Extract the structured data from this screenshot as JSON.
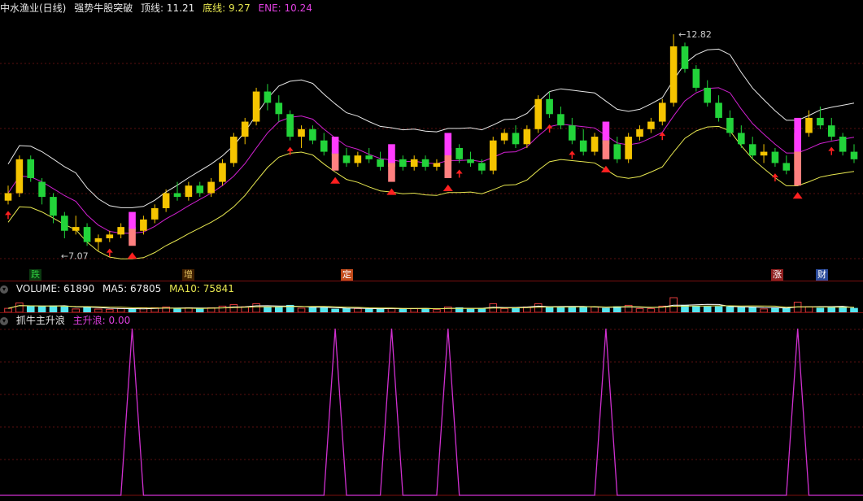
{
  "colors": {
    "up": "#f5c400",
    "down": "#22d33a",
    "top_line": "#e8e8e8",
    "mid_line": "#d020d0",
    "bottom_line": "#e8e850",
    "vol_up": "#e03b3b",
    "vol_down": "#55e6f0",
    "ma5": "#ffffff",
    "ma10": "#e8e850",
    "signal": "#d030d0",
    "marker": "#ff2020",
    "highlight": "#ff3cff"
  },
  "main": {
    "stock": "中水渔业(日线)",
    "indicator": "强势牛股突破",
    "top_label": "顶线:",
    "top_value": "11.21",
    "bottom_label": "底线:",
    "bottom_value": "9.27",
    "ene_label": "ENE:",
    "ene_value": "10.24",
    "high_label": "12.82",
    "low_label": "7.07",
    "tags": [
      {
        "text": "跌",
        "color": "#2fd040",
        "bg": "#0b3a10"
      },
      {
        "text": "增",
        "color": "#e0c060",
        "bg": "#402000"
      },
      {
        "text": "定",
        "color": "#ffffff",
        "bg": "#c04a1a"
      },
      {
        "text": "涨",
        "color": "#ffffff",
        "bg": "#902020"
      },
      {
        "text": "财",
        "color": "#ffffff",
        "bg": "#2a4a9a"
      }
    ]
  },
  "volume": {
    "label": "VOLUME:",
    "value": "61890",
    "ma5_label": "MA5:",
    "ma5_value": "67805",
    "ma10_label": "MA10:",
    "ma10_value": "75841"
  },
  "indicator": {
    "name": "抓牛主升浪",
    "series_label": "主升浪:",
    "series_value": "0.00"
  },
  "chart_data": {
    "type": "candlestick",
    "candles_ohlc": [
      [
        8.4,
        8.8,
        8.3,
        8.6
      ],
      [
        8.6,
        9.6,
        8.5,
        9.5
      ],
      [
        9.5,
        9.6,
        8.9,
        9.0
      ],
      [
        8.9,
        9.0,
        8.3,
        8.5
      ],
      [
        8.5,
        8.6,
        7.8,
        8.0
      ],
      [
        8.0,
        8.1,
        7.4,
        7.6
      ],
      [
        7.6,
        8.0,
        7.5,
        7.7
      ],
      [
        7.7,
        7.8,
        7.2,
        7.3
      ],
      [
        7.3,
        7.5,
        7.07,
        7.4
      ],
      [
        7.4,
        7.6,
        7.3,
        7.5
      ],
      [
        7.5,
        7.8,
        7.4,
        7.7
      ],
      [
        7.7,
        7.9,
        7.5,
        7.6
      ],
      [
        7.6,
        8.0,
        7.5,
        7.9
      ],
      [
        7.9,
        8.3,
        7.8,
        8.2
      ],
      [
        8.2,
        8.7,
        8.1,
        8.6
      ],
      [
        8.6,
        8.9,
        8.4,
        8.5
      ],
      [
        8.5,
        8.9,
        8.4,
        8.8
      ],
      [
        8.8,
        8.9,
        8.5,
        8.6
      ],
      [
        8.6,
        9.0,
        8.5,
        8.9
      ],
      [
        8.9,
        9.5,
        8.8,
        9.4
      ],
      [
        9.4,
        10.2,
        9.3,
        10.1
      ],
      [
        10.1,
        10.6,
        9.9,
        10.5
      ],
      [
        10.5,
        11.4,
        10.4,
        11.3
      ],
      [
        11.3,
        11.5,
        10.8,
        11.0
      ],
      [
        11.0,
        11.2,
        10.5,
        10.7
      ],
      [
        10.7,
        10.8,
        10.0,
        10.1
      ],
      [
        10.1,
        10.4,
        9.8,
        10.3
      ],
      [
        10.3,
        10.4,
        9.9,
        10.0
      ],
      [
        10.0,
        10.2,
        9.6,
        9.7
      ],
      [
        9.7,
        9.9,
        9.5,
        9.6
      ],
      [
        9.6,
        9.8,
        9.3,
        9.4
      ],
      [
        9.4,
        9.7,
        9.3,
        9.6
      ],
      [
        9.6,
        9.8,
        9.4,
        9.5
      ],
      [
        9.5,
        9.7,
        9.2,
        9.3
      ],
      [
        9.3,
        9.6,
        9.2,
        9.5
      ],
      [
        9.5,
        9.6,
        9.2,
        9.3
      ],
      [
        9.3,
        9.6,
        9.2,
        9.5
      ],
      [
        9.5,
        9.6,
        9.2,
        9.3
      ],
      [
        9.3,
        9.5,
        9.2,
        9.4
      ],
      [
        9.4,
        9.9,
        9.3,
        9.8
      ],
      [
        9.8,
        9.9,
        9.4,
        9.5
      ],
      [
        9.5,
        9.7,
        9.3,
        9.4
      ],
      [
        9.4,
        9.5,
        9.1,
        9.2
      ],
      [
        9.2,
        10.1,
        9.1,
        10.0
      ],
      [
        10.0,
        10.3,
        9.9,
        10.2
      ],
      [
        10.2,
        10.4,
        9.8,
        9.9
      ],
      [
        9.9,
        10.4,
        9.8,
        10.3
      ],
      [
        10.3,
        11.2,
        10.2,
        11.1
      ],
      [
        11.1,
        11.3,
        10.6,
        10.7
      ],
      [
        10.7,
        10.9,
        10.3,
        10.4
      ],
      [
        10.4,
        10.6,
        9.9,
        10.0
      ],
      [
        10.0,
        10.3,
        9.6,
        9.7
      ],
      [
        9.7,
        10.2,
        9.6,
        10.1
      ],
      [
        10.1,
        10.3,
        9.8,
        9.9
      ],
      [
        9.9,
        10.1,
        9.4,
        9.5
      ],
      [
        9.5,
        10.2,
        9.4,
        10.1
      ],
      [
        10.1,
        10.4,
        10.0,
        10.3
      ],
      [
        10.3,
        10.6,
        10.2,
        10.5
      ],
      [
        10.5,
        11.1,
        10.4,
        11.0
      ],
      [
        11.0,
        12.82,
        10.9,
        12.5
      ],
      [
        12.5,
        12.6,
        11.8,
        11.9
      ],
      [
        11.9,
        12.0,
        11.3,
        11.4
      ],
      [
        11.4,
        11.6,
        10.9,
        11.0
      ],
      [
        11.0,
        11.2,
        10.5,
        10.6
      ],
      [
        10.6,
        10.8,
        10.1,
        10.2
      ],
      [
        10.2,
        10.4,
        9.8,
        9.9
      ],
      [
        9.9,
        10.1,
        9.5,
        9.6
      ],
      [
        9.6,
        9.9,
        9.4,
        9.7
      ],
      [
        9.7,
        9.8,
        9.3,
        9.4
      ],
      [
        9.4,
        9.6,
        9.1,
        9.2
      ],
      [
        9.2,
        10.3,
        9.1,
        10.2
      ],
      [
        10.2,
        10.8,
        10.1,
        10.6
      ],
      [
        10.6,
        10.9,
        10.3,
        10.4
      ],
      [
        10.4,
        10.6,
        10.0,
        10.1
      ],
      [
        10.1,
        10.2,
        9.6,
        9.7
      ],
      [
        9.7,
        9.9,
        9.4,
        9.5
      ]
    ],
    "signal_spikes_at": [
      11,
      29,
      34,
      39,
      53,
      70
    ],
    "markers_at": [
      0,
      9,
      25,
      40,
      48,
      50,
      58,
      68,
      73
    ]
  }
}
